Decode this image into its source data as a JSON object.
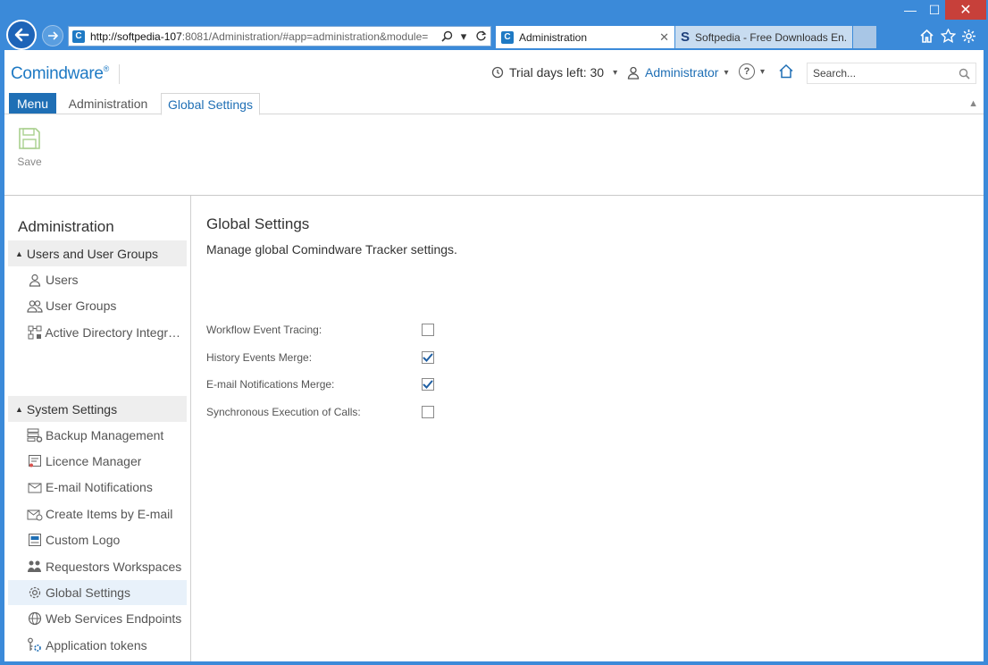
{
  "browser": {
    "url_prefix": "http://softpedia-107",
    "url_rest": ":8081/Administration/#app=administration&module=",
    "tabs": [
      {
        "title": "Administration",
        "favicon": "C"
      },
      {
        "title": "Softpedia - Free Downloads En...",
        "favicon": "S"
      }
    ],
    "window_controls": {
      "minimize": "—",
      "maximize": "☐",
      "close": "✕"
    }
  },
  "header": {
    "logo": "Comindware",
    "logo_mark": "®",
    "trial_text": "Trial days left: 30",
    "user_name": "Administrator",
    "help_glyph": "?",
    "search_placeholder": "Search..."
  },
  "app_tabs": {
    "menu": "Menu",
    "admin": "Administration",
    "global_settings": "Global Settings"
  },
  "ribbon": {
    "save_label": "Save"
  },
  "sidebar": {
    "title": "Administration",
    "groups": [
      {
        "label": "Users and User Groups"
      },
      {
        "label": "System Settings"
      }
    ],
    "items": [
      {
        "label": "Users"
      },
      {
        "label": "User Groups"
      },
      {
        "label": "Active Directory Integrati..."
      },
      {
        "label": "Backup Management"
      },
      {
        "label": "Licence Manager"
      },
      {
        "label": "E-mail Notifications"
      },
      {
        "label": "Create Items by E-mail"
      },
      {
        "label": "Custom Logo"
      },
      {
        "label": "Requestors Workspaces"
      },
      {
        "label": "Global Settings"
      },
      {
        "label": "Web Services Endpoints"
      },
      {
        "label": "Application tokens"
      }
    ]
  },
  "main": {
    "title": "Global Settings",
    "description": "Manage global Comindware Tracker settings.",
    "settings": [
      {
        "label": "Workflow Event Tracing:",
        "checked": false
      },
      {
        "label": "History Events Merge:",
        "checked": true
      },
      {
        "label": "E-mail Notifications Merge:",
        "checked": true
      },
      {
        "label": "Synchronous Execution of Calls:",
        "checked": false
      }
    ]
  },
  "colors": {
    "accent": "#1f6fb5",
    "frame": "#3b8ad9",
    "selected_bg": "#e8f1fa"
  }
}
